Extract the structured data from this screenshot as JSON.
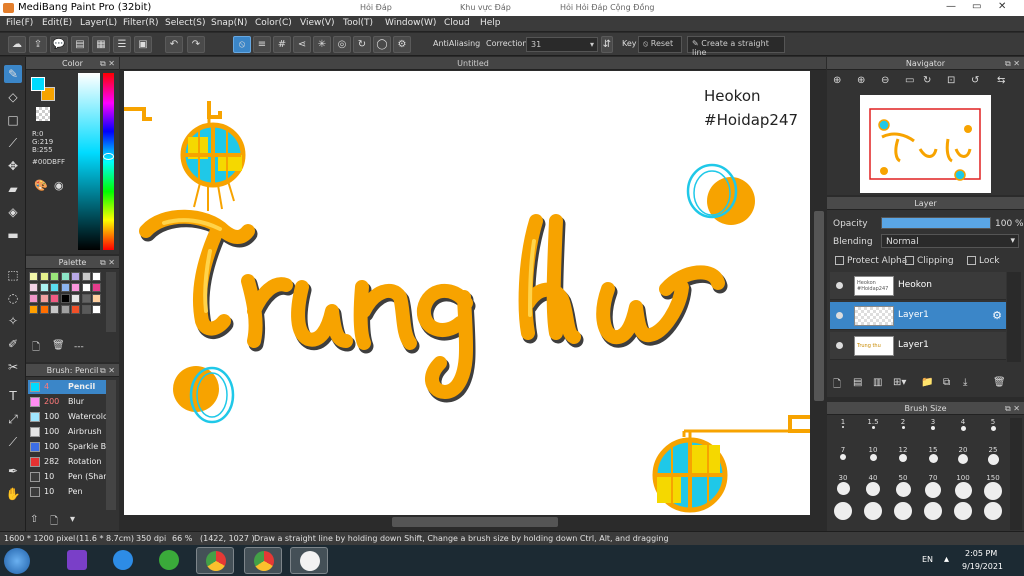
{
  "window": {
    "title": "MediBang Paint Pro (32bit)",
    "browser_tabs": [
      "Hỏi Đáp",
      "Khu vực Đáp",
      "Hỏi Hỏi Đáp Cộng Đồng"
    ]
  },
  "menu": [
    "File(F)",
    "Edit(E)",
    "Layer(L)",
    "Filter(R)",
    "Select(S)",
    "Snap(N)",
    "Color(C)",
    "View(V)",
    "Tool(T)",
    "Window(W)",
    "Cloud",
    "Help"
  ],
  "toolbar": {
    "antialiasing_label": "AntiAliasing",
    "correction_label": "Correction",
    "correction_value": "31",
    "key_label": "Key",
    "reset_label": "Reset",
    "straight_line_label": "Create a straight line"
  },
  "color_panel": {
    "title": "Color",
    "r": "R:0",
    "g": "G:219",
    "b": "B:255",
    "hex": "#00DBFF",
    "fg_color": "#00dbff",
    "bg_color": "#f7a300"
  },
  "palette": {
    "title": "Palette",
    "footer": "---",
    "colors": [
      "#f2f7aa",
      "#e6f28c",
      "#9ae67a",
      "#8ce6c8",
      "#b8a8e6",
      "#c8c8c8",
      "#fff",
      "#f2d2e6",
      "#aaf2f2",
      "#5adcf0",
      "#8cb4f0",
      "#fa96dc",
      "#fff",
      "#e63c8c",
      "#f096c8",
      "#f0a0a0",
      "#f05a82",
      "#000",
      "#e6e6e6",
      "#646464",
      "#ffd0a0",
      "#ffa000",
      "#ff6e00",
      "#c8c8c8",
      "#a0a0a0",
      "#f05028",
      "#5a5a5a",
      "#ffffff"
    ]
  },
  "brush_panel": {
    "title": "Brush: Pencil",
    "items": [
      {
        "size": "4",
        "name": "Pencil",
        "color": "#00dbff"
      },
      {
        "size": "200",
        "name": "Blur",
        "color": "#ff8cf0"
      },
      {
        "size": "100",
        "name": "Watercolor",
        "color": "#a0e6ff"
      },
      {
        "size": "100",
        "name": "Airbrush",
        "color": "#e6e6e6"
      },
      {
        "size": "100",
        "name": "Sparkle Brush",
        "color": "#3c6ee6"
      },
      {
        "size": "282",
        "name": "Rotation",
        "color": "#e63232"
      },
      {
        "size": "10",
        "name": "Pen (Sharp)",
        "color": "#3c3c3c"
      },
      {
        "size": "10",
        "name": "Pen",
        "color": "#3c3c3c"
      }
    ]
  },
  "canvas": {
    "doc_title": "Untitled",
    "watermark_line1": "Heokon",
    "watermark_line2": "#Hoidap247",
    "lettering": "Trung thu",
    "accent_yellow": "#f7a300",
    "accent_cyan": "#1fc8e8"
  },
  "navigator": {
    "title": "Navigator"
  },
  "layers": {
    "title": "Layer",
    "opacity_label": "Opacity",
    "opacity_value": "100 %",
    "opacity_fraction": 1.0,
    "blending_label": "Blending",
    "blending_value": "Normal",
    "protect_alpha": "Protect Alpha",
    "clipping": "Clipping",
    "lock": "Lock",
    "items": [
      {
        "name": "Heokon",
        "thumb": "Heokon #Hoidap247",
        "selected": false
      },
      {
        "name": "Layer1",
        "thumb": "",
        "selected": true
      },
      {
        "name": "Layer1",
        "thumb": "Trung thu",
        "selected": false
      }
    ]
  },
  "brush_size": {
    "title": "Brush Size",
    "sizes": [
      "1",
      "1.5",
      "2",
      "3",
      "4",
      "5",
      "7",
      "10",
      "12",
      "15",
      "20",
      "25",
      "30",
      "40",
      "50",
      "70",
      "100",
      "150",
      "",
      "",
      "",
      "",
      "",
      ""
    ]
  },
  "status": {
    "dims": "1600 * 1200 pixel",
    "physical": "(11.6 * 8.7cm)",
    "dpi": "350 dpi",
    "zoom": "66 %",
    "coords": "(1422, 1027 )",
    "hint": "Draw a straight line by holding down Shift, Change a brush size by holding down Ctrl, Alt, and dragging"
  },
  "taskbar": {
    "lang": "EN",
    "time": "2:05 PM",
    "date": "9/19/2021"
  }
}
